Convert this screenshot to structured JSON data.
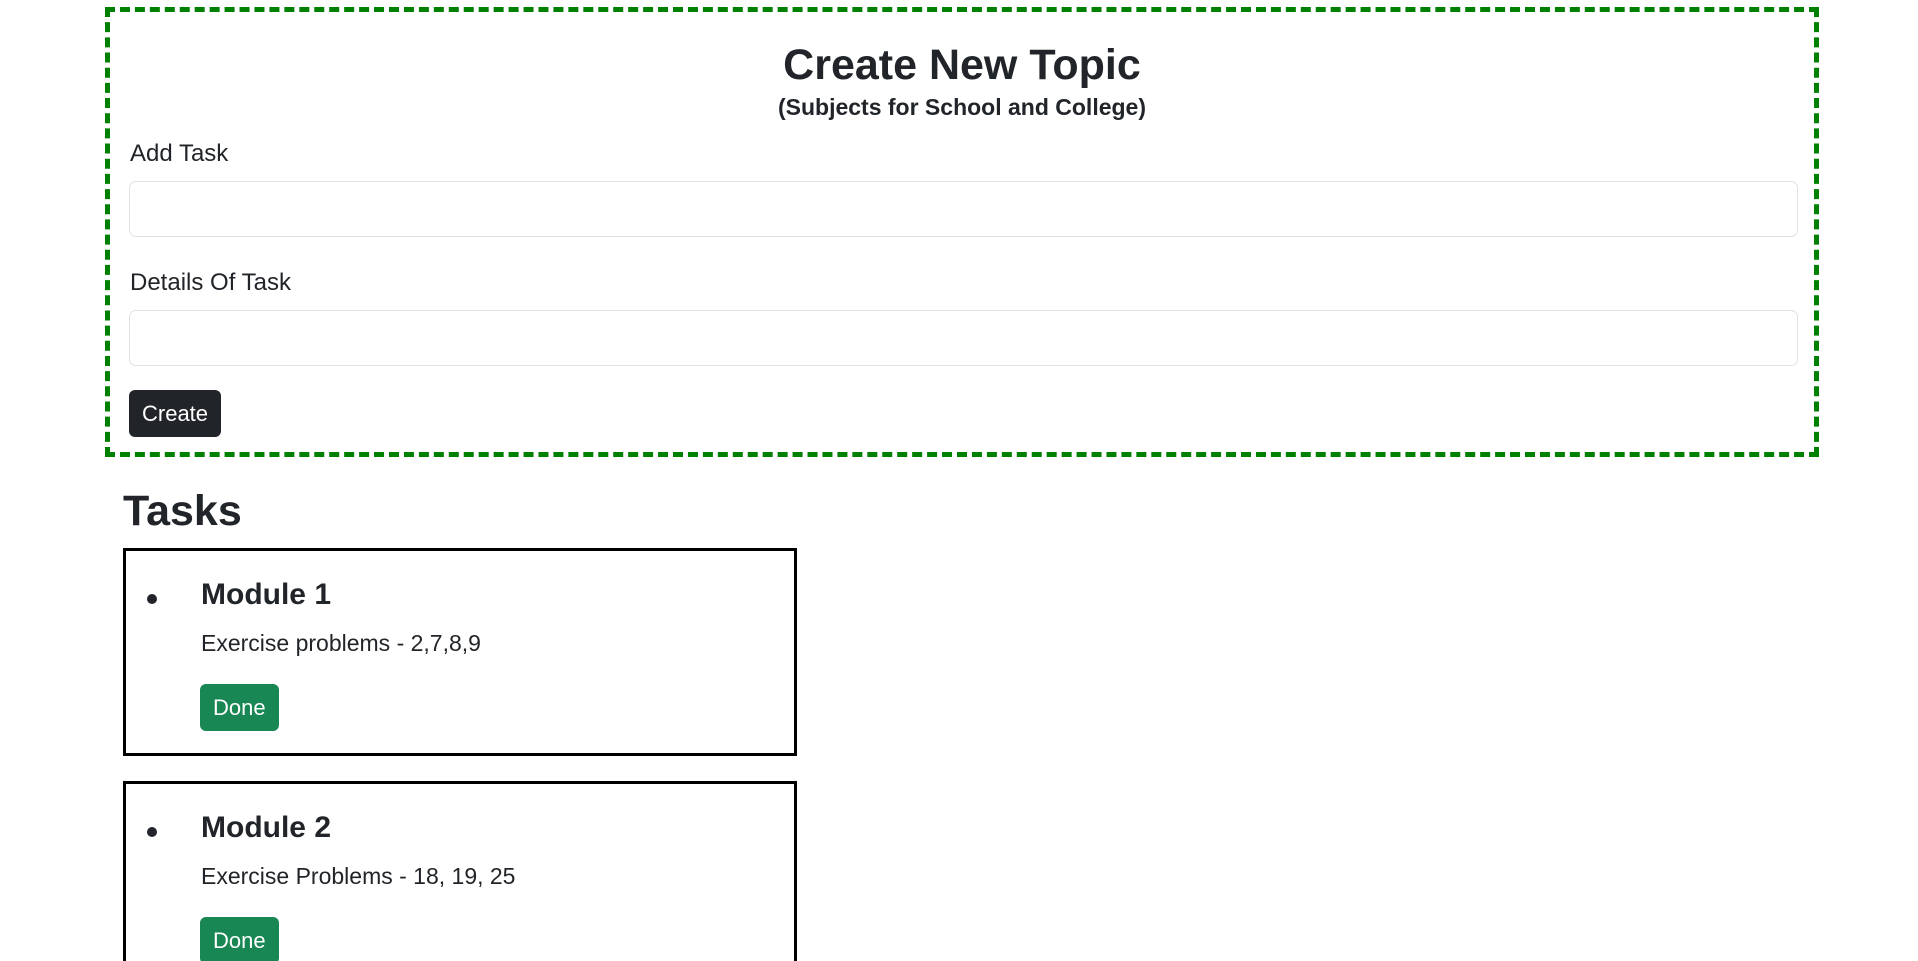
{
  "form": {
    "title": "Create New Topic",
    "subtitle": "(Subjects for School and College)",
    "task_label": "Add Task",
    "task_value": "",
    "task_placeholder": "",
    "details_label": "Details Of Task",
    "details_value": "",
    "details_placeholder": "",
    "create_label": "Create",
    "border_color": "#008000",
    "button_color": "#212529"
  },
  "tasks": {
    "heading": "Tasks",
    "items": [
      {
        "name": "Module 1",
        "details": "Exercise problems - 2,7,8,9",
        "done_label": "Done"
      },
      {
        "name": "Module 2",
        "details": "Exercise Problems - 18, 19, 25",
        "done_label": "Done"
      }
    ],
    "done_color": "#198754"
  }
}
